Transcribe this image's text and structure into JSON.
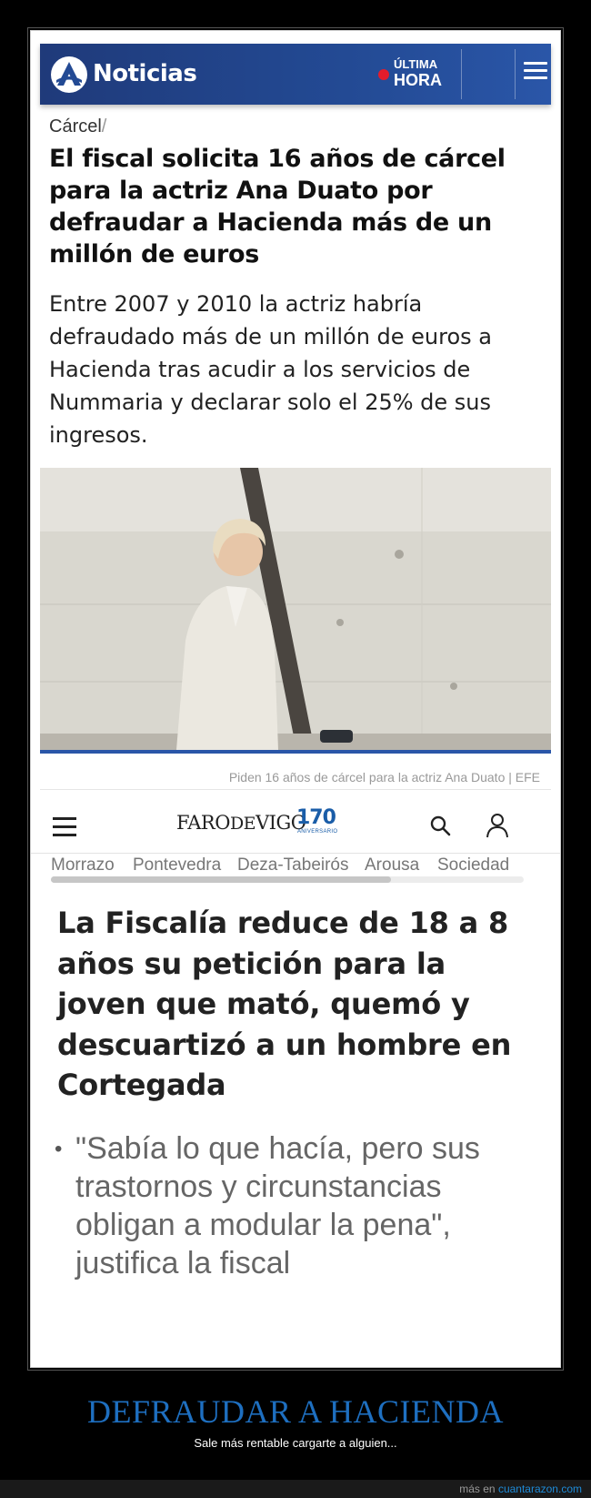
{
  "antena3": {
    "brand": "Noticias",
    "ultima": "ÚLTIMA",
    "hora": "HORA",
    "section": "Cárcel",
    "section_sep": "/",
    "headline": "El fiscal solicita 16 años de cárcel para la actriz Ana Duato por defraudar a Hacienda más de un millón de euros",
    "lead": "Entre 2007 y 2010 la actriz habría defraudado más de un millón de euros a Hacienda tras acudir a los servicios de Nummaria y declarar solo el 25% de sus ingresos.",
    "caption": "Piden 16 años de cárcel para la actriz Ana Duato | EFE"
  },
  "farodevigo": {
    "logo_faro": "FARO",
    "logo_de": "DE",
    "logo_vigo": "VIGO",
    "logo_anniv": "170",
    "logo_anniv_sub": "ANIVERSARIO",
    "nav": [
      "Morrazo",
      "Pontevedra",
      "Deza-Tabeirós",
      "Arousa",
      "Sociedad"
    ],
    "headline": "La Fiscalía reduce de 18 a 8 años su petición para la joven que mató, quemó y descuartizó a un hombre en Cortegada",
    "bullet": "•",
    "quote": "\"Sabía lo que hacía, pero sus trastornos y circunstancias obligan a modular la pena\", justifica la fiscal"
  },
  "meme": {
    "title": "DEFRAUDAR A HACIENDA",
    "subtitle": "Sale más rentable cargarte a alguien...",
    "more_text": "más en ",
    "site": "cuantarazon.com"
  },
  "colors": {
    "antena3_blue": "#234a94",
    "live_red": "#e41c2c",
    "title_blue": "#1e6fc0",
    "link_blue": "#1e8ad6"
  }
}
